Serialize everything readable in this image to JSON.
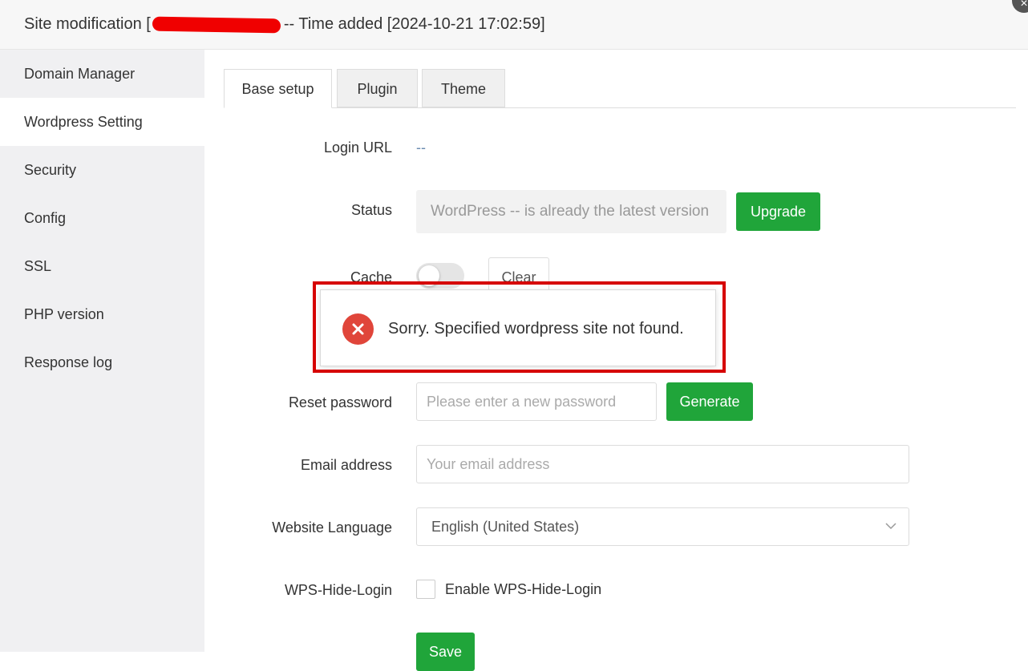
{
  "header": {
    "title_prefix": "Site modification [",
    "title_suffix": "-- Time added [2024-10-21 17:02:59]",
    "close_label": "×"
  },
  "sidebar": {
    "items": [
      {
        "label": "Domain Manager"
      },
      {
        "label": "Wordpress Setting"
      },
      {
        "label": "Security"
      },
      {
        "label": "Config"
      },
      {
        "label": "SSL"
      },
      {
        "label": "PHP version"
      },
      {
        "label": "Response log"
      }
    ],
    "active": "Wordpress Setting"
  },
  "tabs": [
    {
      "label": "Base setup"
    },
    {
      "label": "Plugin"
    },
    {
      "label": "Theme"
    }
  ],
  "form": {
    "login_url_label": "Login URL",
    "login_url_value": "--",
    "status_label": "Status",
    "status_value": "WordPress -- is already the latest version",
    "upgrade_label": "Upgrade",
    "cache_label": "Cache",
    "clear_label": "Clear",
    "reset_password_label": "Reset password",
    "reset_password_placeholder": "Please enter a new password",
    "generate_label": "Generate",
    "email_label": "Email address",
    "email_placeholder": "Your email address",
    "language_label": "Website Language",
    "language_value": "English (United States)",
    "wps_label": "WPS-Hide-Login",
    "wps_checkbox_label": "Enable WPS-Hide-Login",
    "save_label": "Save"
  },
  "toast": {
    "message": "Sorry. Specified wordpress site not found."
  },
  "colors": {
    "accent_green": "#20a53a",
    "error_red": "#e0453a",
    "highlight_red": "#d60000"
  }
}
